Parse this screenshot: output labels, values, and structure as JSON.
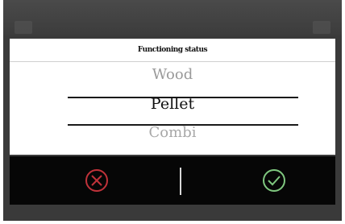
{
  "dialog": {
    "title": "Functioning status"
  },
  "picker": {
    "previous": "Wood",
    "selected": "Pellet",
    "next": "Combi"
  },
  "actions": {
    "cancel_icon": "cancel-icon",
    "confirm_icon": "check-icon",
    "cancel_color": "#c0323a",
    "confirm_color": "#7fc77f"
  }
}
